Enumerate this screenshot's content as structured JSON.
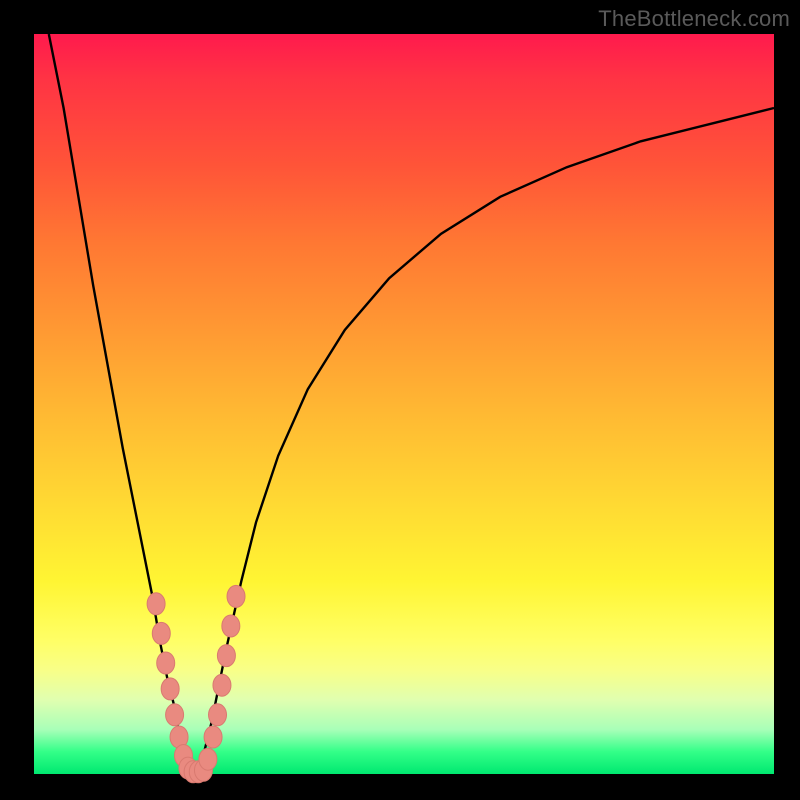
{
  "watermark": "TheBottleneck.com",
  "colors": {
    "frame": "#000000",
    "curve": "#000000",
    "marker_fill": "#e98a80",
    "marker_stroke": "#d97a70"
  },
  "chart_data": {
    "type": "line",
    "title": "",
    "xlabel": "",
    "ylabel": "",
    "xlim": [
      0,
      100
    ],
    "ylim": [
      0,
      100
    ],
    "note": "No axis ticks or numeric labels are visible; x and y are normalized 0–100. The two black curves form a V-shaped bottleneck profile against a vertical red→green gradient. Salmon markers decorate points near the valley.",
    "series": [
      {
        "name": "left-curve",
        "x": [
          2,
          4,
          6,
          8,
          10,
          12,
          14,
          16,
          17,
          18,
          19,
          19.5,
          20,
          20.5,
          21,
          21.5
        ],
        "y": [
          100,
          90,
          78,
          66,
          55,
          44,
          34,
          24,
          18,
          13,
          9,
          6,
          4,
          2.5,
          1.2,
          0
        ]
      },
      {
        "name": "right-curve",
        "x": [
          22,
          23,
          24,
          25,
          26,
          28,
          30,
          33,
          37,
          42,
          48,
          55,
          63,
          72,
          82,
          92,
          100
        ],
        "y": [
          0,
          3,
          7,
          12,
          17,
          26,
          34,
          43,
          52,
          60,
          67,
          73,
          78,
          82,
          85.5,
          88,
          90
        ]
      }
    ],
    "markers": [
      {
        "x": 16.5,
        "y": 23
      },
      {
        "x": 17.2,
        "y": 19
      },
      {
        "x": 17.8,
        "y": 15
      },
      {
        "x": 18.4,
        "y": 11.5
      },
      {
        "x": 19.0,
        "y": 8
      },
      {
        "x": 19.6,
        "y": 5
      },
      {
        "x": 20.2,
        "y": 2.5
      },
      {
        "x": 20.8,
        "y": 0.8
      },
      {
        "x": 21.5,
        "y": 0.3
      },
      {
        "x": 22.2,
        "y": 0.3
      },
      {
        "x": 22.9,
        "y": 0.5
      },
      {
        "x": 23.5,
        "y": 2
      },
      {
        "x": 24.2,
        "y": 5
      },
      {
        "x": 24.8,
        "y": 8
      },
      {
        "x": 25.4,
        "y": 12
      },
      {
        "x": 26.0,
        "y": 16
      },
      {
        "x": 26.6,
        "y": 20
      },
      {
        "x": 27.3,
        "y": 24
      }
    ]
  }
}
